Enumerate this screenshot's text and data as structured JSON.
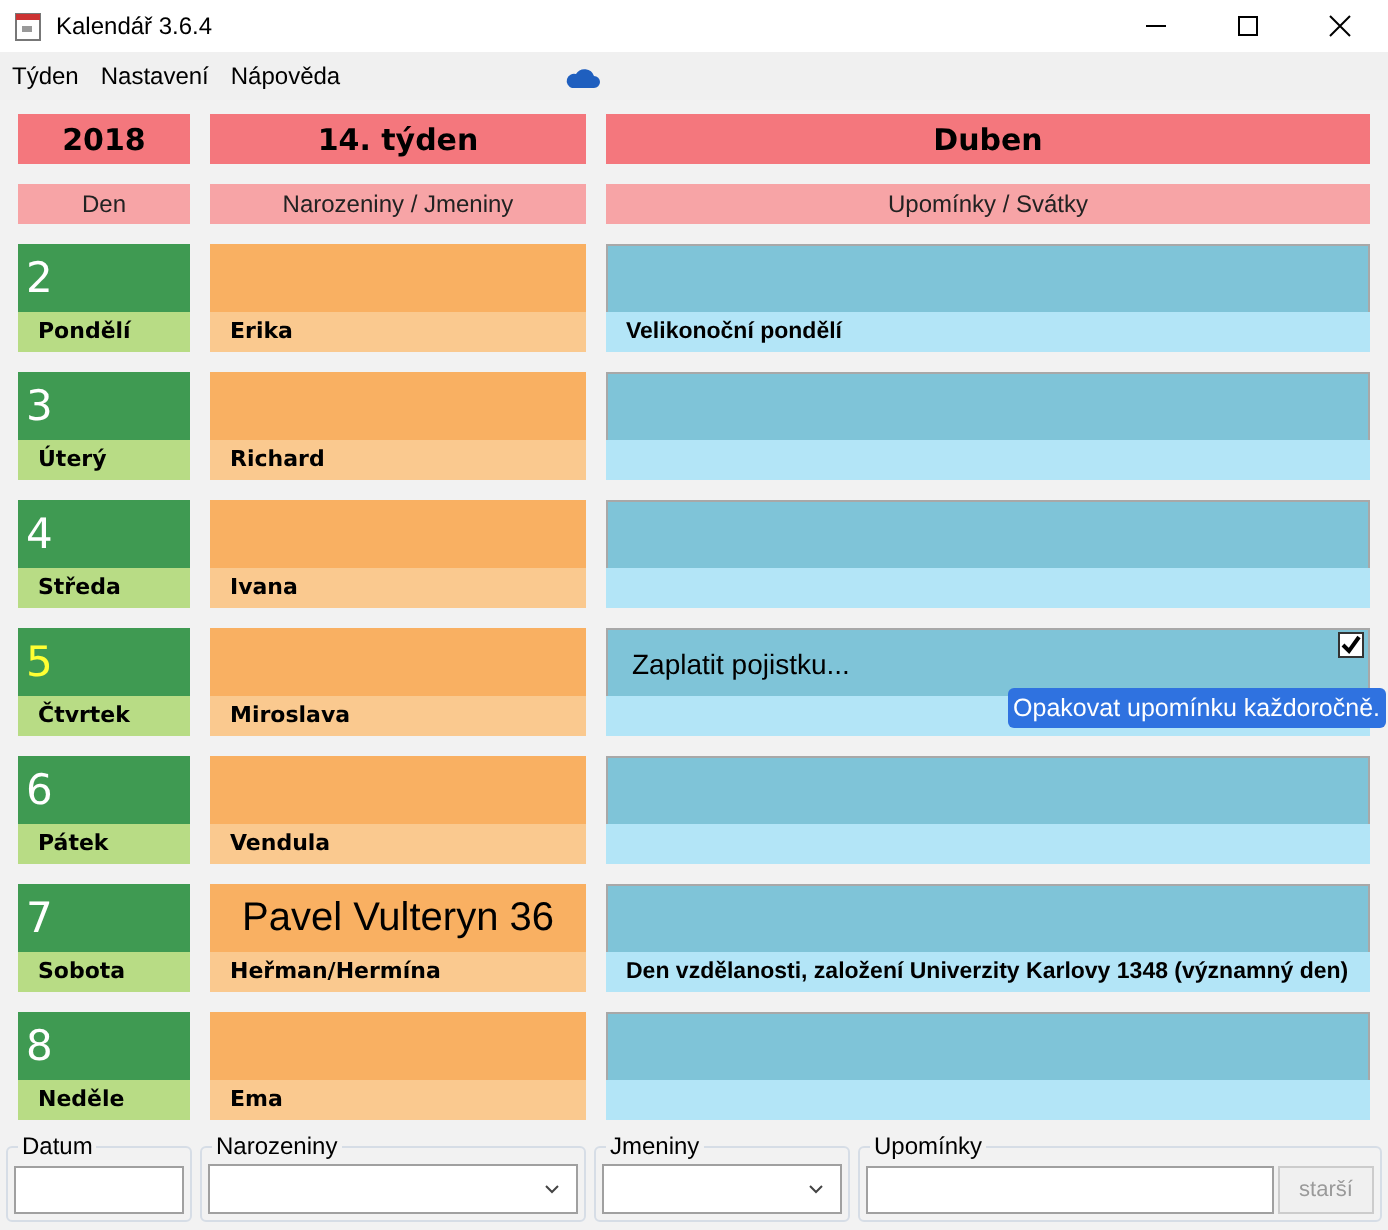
{
  "window": {
    "title": "Kalendář 3.6.4"
  },
  "menu": [
    "Týden",
    "Nastavení",
    "Nápověda"
  ],
  "header": {
    "year": "2018",
    "week": "14. týden",
    "month": "Duben"
  },
  "columns": [
    "Den",
    "Narozeniny / Jmeniny",
    "Upomínky / Svátky"
  ],
  "days": [
    {
      "number": "2",
      "weekday": "Pondělí",
      "today": false,
      "nameday": "Erika",
      "holiday": "Velikonoční pondělí"
    },
    {
      "number": "3",
      "weekday": "Úterý",
      "today": false,
      "nameday": "Richard"
    },
    {
      "number": "4",
      "weekday": "Středa",
      "today": false,
      "nameday": "Ivana"
    },
    {
      "number": "5",
      "weekday": "Čtvrtek",
      "today": true,
      "nameday": "Miroslava",
      "reminder": {
        "text": "Zaplatit pojistku...",
        "repeat_yearly": true,
        "tooltip": "Opakovat upomínku každoročně."
      }
    },
    {
      "number": "6",
      "weekday": "Pátek",
      "today": false,
      "nameday": "Vendula"
    },
    {
      "number": "7",
      "weekday": "Sobota",
      "today": false,
      "birthday": "Pavel Vulteryn 36",
      "nameday": "Heřman/Hermína",
      "holiday": "Den vzdělanosti, založení Univerzity Karlovy 1348 (významný den)"
    },
    {
      "number": "8",
      "weekday": "Neděle",
      "today": false,
      "nameday": "Ema"
    }
  ],
  "filters": [
    {
      "label": "Datum",
      "kind": "text"
    },
    {
      "label": "Narozeniny",
      "kind": "combo"
    },
    {
      "label": "Jmeniny",
      "kind": "combo"
    },
    {
      "label": "Upomínky",
      "kind": "text-button",
      "button": "starší",
      "button_disabled": true
    }
  ]
}
